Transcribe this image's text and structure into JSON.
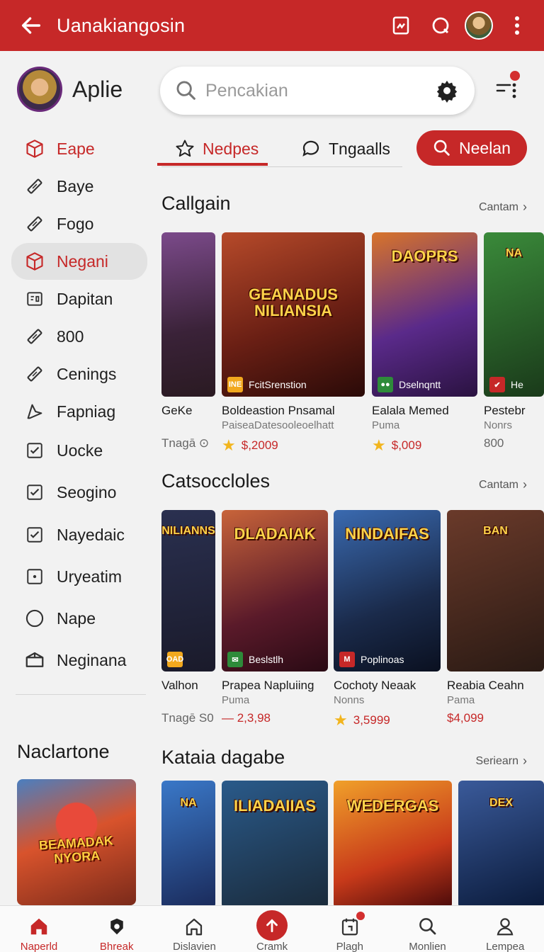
{
  "app_bar": {
    "title": "Uanakiangosin"
  },
  "profile": {
    "name": "Aplie"
  },
  "sidebar": {
    "items": [
      {
        "label": "Eape",
        "icon": "box-icon",
        "style": "red"
      },
      {
        "label": "Baye",
        "icon": "tag-icon",
        "style": "normal"
      },
      {
        "label": "Fogo",
        "icon": "tag-icon",
        "style": "normal"
      },
      {
        "label": "Negani",
        "icon": "box-icon",
        "style": "active"
      },
      {
        "label": "Dapitan",
        "icon": "id-card-icon",
        "style": "normal"
      },
      {
        "label": "800",
        "icon": "tag-icon",
        "style": "normal"
      },
      {
        "label": "Cenings",
        "icon": "tag-icon",
        "style": "normal"
      },
      {
        "label": "Fapniag",
        "icon": "pennant-icon",
        "style": "normal"
      },
      {
        "label": "Uocke",
        "icon": "checkbox-icon",
        "style": "normal"
      },
      {
        "label": "Seogino",
        "icon": "checkbox-icon",
        "style": "normal"
      },
      {
        "label": "Nayedaic",
        "icon": "checkbox-icon",
        "style": "normal"
      },
      {
        "label": "Uryeatim",
        "icon": "square-dot-icon",
        "style": "normal"
      },
      {
        "label": "Nape",
        "icon": "circle-icon",
        "style": "normal"
      },
      {
        "label": "Neginana",
        "icon": "package-icon",
        "style": "normal"
      }
    ],
    "bottom_heading": "Naclartone",
    "promo_art_text": "BEAMADAK NYORA"
  },
  "search": {
    "placeholder": "Pencakian"
  },
  "tabs": [
    {
      "label": "Nedpes"
    },
    {
      "label": "Tngaalls"
    }
  ],
  "search_button": {
    "label": "Neelan"
  },
  "sections": [
    {
      "title": "Callgain",
      "more": "Cantam",
      "cards": [
        {
          "name": "GeKe",
          "sub": "",
          "price": "Tnagā ⊙",
          "price_style": "grey",
          "star": false,
          "art": "",
          "badge": ""
        },
        {
          "name": "Boldeastion Pnsamal",
          "sub": "PaiseaDatesooleoelhatt",
          "price": "$,2009",
          "price_style": "red",
          "star": true,
          "art": "GEANADUS NILIANSIA",
          "badge": "FcitSrenstion",
          "badge_icon": "INE"
        },
        {
          "name": "Ealala Memed",
          "sub": "Puma",
          "price": "$,009",
          "price_style": "red",
          "star": true,
          "art": "DAOPRS",
          "badge": "Dselnqntt",
          "badge_icon": "●●"
        },
        {
          "name": "Pestebr",
          "sub": "Nonrs",
          "price": "800",
          "price_style": "grey",
          "star": false,
          "art": "NA",
          "badge": "He",
          "badge_icon": "✔"
        }
      ]
    },
    {
      "title": "Catsoccloles",
      "more": "Cantam",
      "cards": [
        {
          "name": "Valhon",
          "sub": "",
          "price": "Tnagē S0",
          "price_style": "grey",
          "star": false,
          "art": "NILIANNS",
          "badge": "",
          "badge_icon": "OAD"
        },
        {
          "name": "Prapea Napluiing",
          "sub": "Puma",
          "price": "— 2,3,98",
          "price_style": "red",
          "star": false,
          "art": "DLADAIAK",
          "badge": "Beslstlh",
          "badge_icon": "✉"
        },
        {
          "name": "Cochoty Neaak",
          "sub": "Nonns",
          "price": "3,5999",
          "price_style": "red",
          "star": true,
          "art": "NINDAIFAS",
          "badge": "Poplinoas",
          "badge_icon": "M"
        },
        {
          "name": "Reabia Ceahn",
          "sub": "Pama",
          "price": "$4,099",
          "price_style": "red",
          "star": false,
          "art": "BAN",
          "badge": "",
          "badge_icon": ""
        }
      ]
    },
    {
      "title": "Kataia dagabe",
      "more": "Seriearn",
      "cards": [
        {
          "art": "NA"
        },
        {
          "art": "ILIADAIIAS"
        },
        {
          "art": "WEDERGAS"
        },
        {
          "art": "DEX"
        }
      ]
    }
  ],
  "bottom_nav": [
    {
      "label": "Naperld",
      "icon": "home-icon",
      "style": "red"
    },
    {
      "label": "Bhreak",
      "icon": "shield-icon",
      "style": "red"
    },
    {
      "label": "Dislavien",
      "icon": "house-outline-icon",
      "style": "normal"
    },
    {
      "label": "Cramk",
      "icon": "upload-icon",
      "style": "fab"
    },
    {
      "label": "Plagh",
      "icon": "calendar-icon",
      "style": "normal"
    },
    {
      "label": "Monlien",
      "icon": "search-icon",
      "style": "normal"
    },
    {
      "label": "Lempea",
      "icon": "person-icon",
      "style": "normal"
    }
  ],
  "colors": {
    "primary": "#c62828",
    "background": "#f2f2f2",
    "star": "#f2b51e"
  }
}
